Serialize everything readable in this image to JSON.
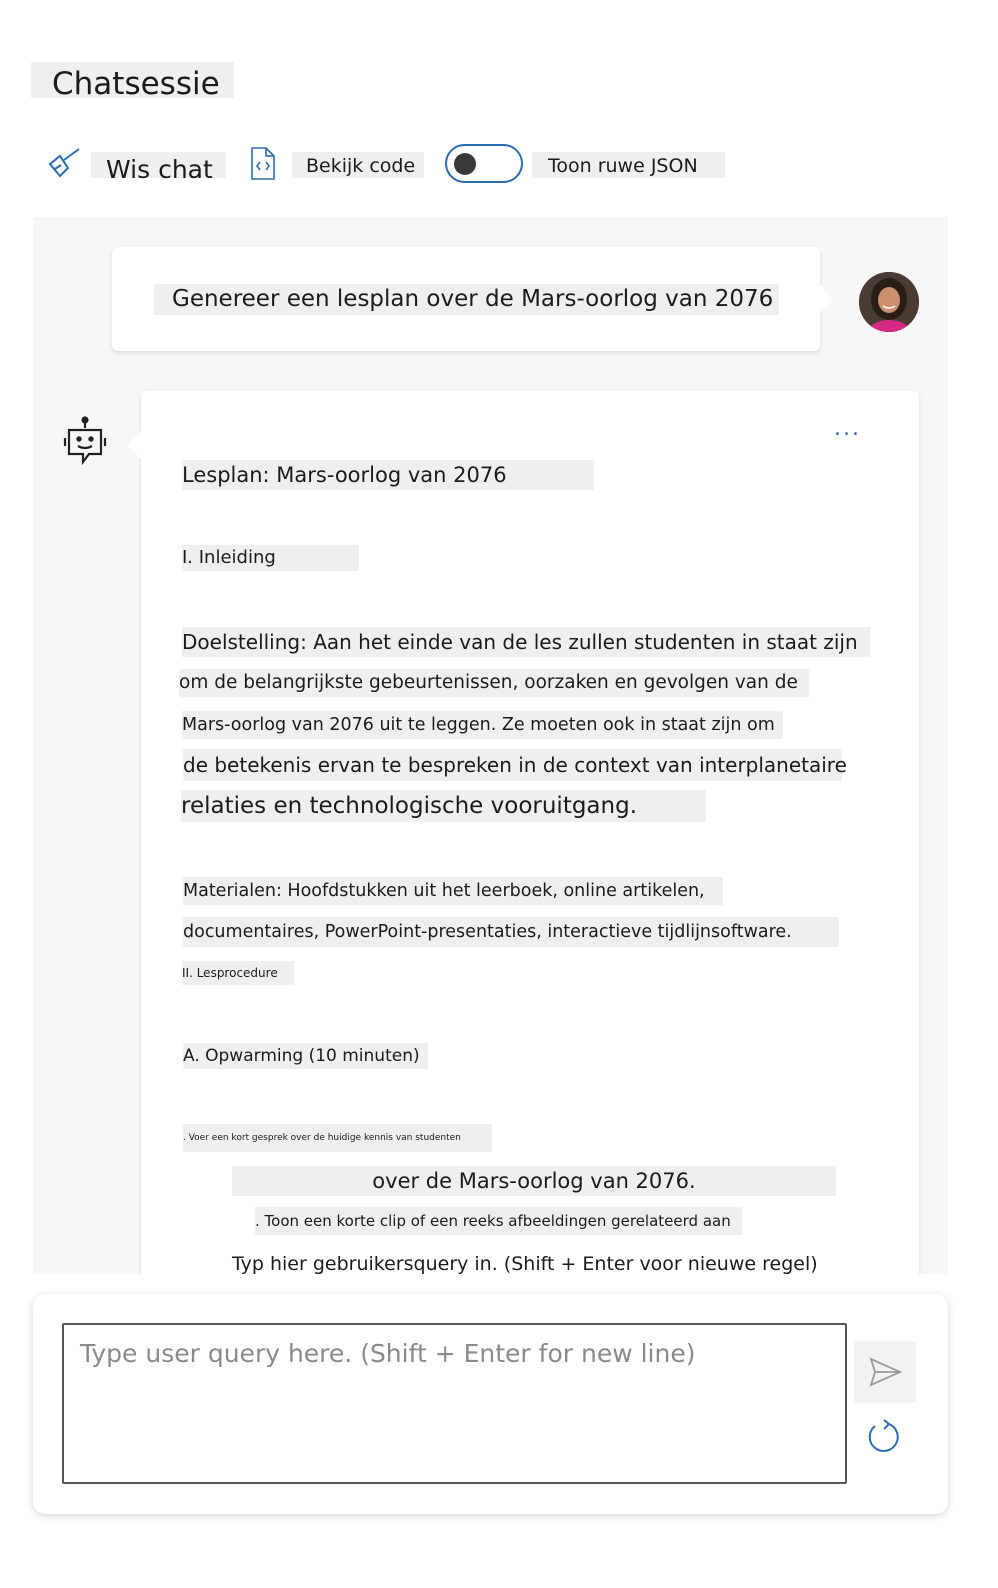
{
  "page": {
    "title": "Chatsessie"
  },
  "toolbar": {
    "clear_label": "Wis chat",
    "code_label": "Bekijk code",
    "json_label": "Toon ruwe JSON",
    "json_toggle_on": false
  },
  "chat": {
    "user_message": "Genereer een lesplan over de Mars-oorlog van 2076",
    "assistant": {
      "more_label": "...",
      "lines": [
        "Lesplan: Mars-oorlog van 2076",
        "I. Inleiding",
        "Doelstelling: Aan het einde van de les zullen studenten in staat zijn",
        "om de belangrijkste gebeurtenissen, oorzaken en gevolgen van de",
        "Mars-oorlog van 2076 uit te leggen. Ze moeten ook in staat zijn om",
        "de betekenis ervan te bespreken in de context van interplanetaire",
        "relaties en technologische vooruitgang.",
        "Materialen: Hoofdstukken uit het leerboek, online artikelen,",
        "documentaires, PowerPoint-presentaties, interactieve tijdlijnsoftware.",
        "II. Lesprocedure",
        "A. Opwarming (10 minuten)",
        ". Voer een kort gesprek over de huidige kennis van studenten",
        "over de Mars-oorlog van 2076.",
        ". Toon een korte clip of een reeks afbeeldingen gerelateerd aan",
        "Typ hier gebruikersquery in. (Shift + Enter voor nieuwe regel)"
      ]
    }
  },
  "input": {
    "placeholder": "Type user query here. (Shift + Enter for new line)"
  },
  "colors": {
    "accent": "#2b6cb0",
    "chat_bg": "#f8f7f6",
    "highlight": "#efefef"
  }
}
